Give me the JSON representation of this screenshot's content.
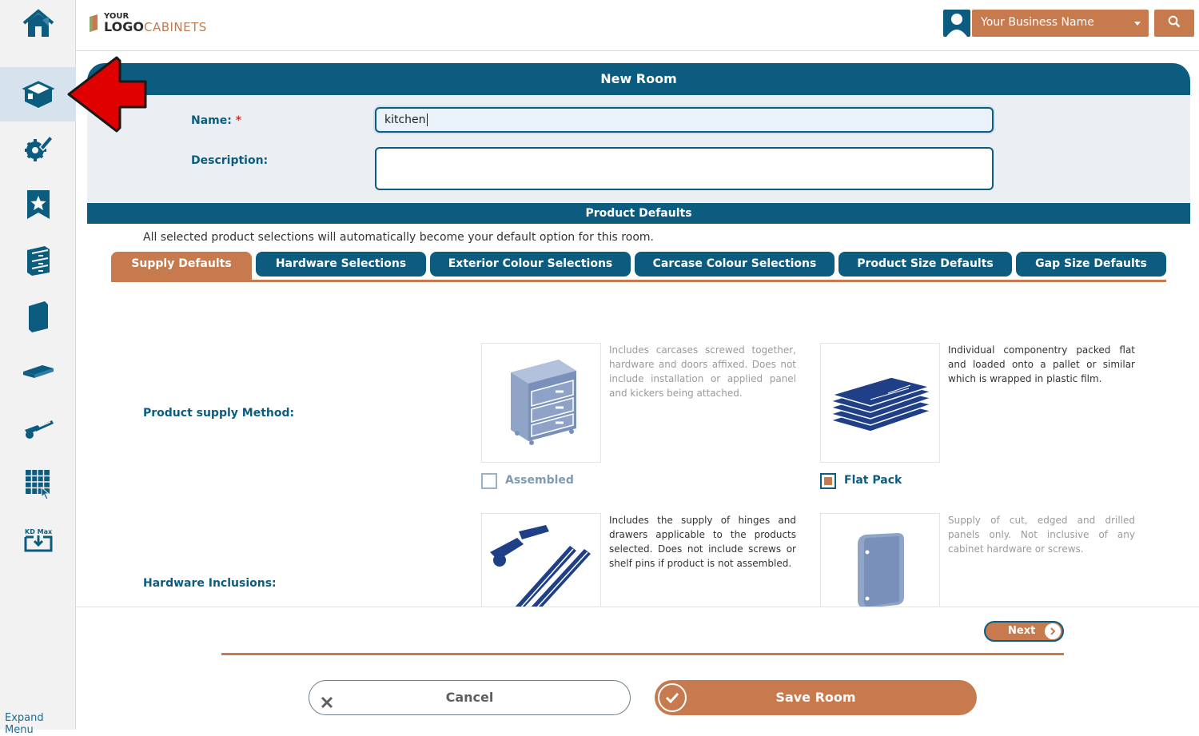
{
  "sidebar": {
    "items": [
      {
        "icon": "home-icon"
      },
      {
        "icon": "room-box-icon",
        "active": true
      },
      {
        "icon": "settings-pencil-icon"
      },
      {
        "icon": "bookmark-star-icon"
      },
      {
        "icon": "cabinet-drawers-icon"
      },
      {
        "icon": "door-panel-icon"
      },
      {
        "icon": "benchtop-icon"
      },
      {
        "icon": "hardware-hinge-icon"
      },
      {
        "icon": "grid-select-icon"
      },
      {
        "icon": "kd-max-import-icon",
        "label": "KD Max"
      }
    ],
    "expand_label": "Expand Menu"
  },
  "header": {
    "logo_your": "YOUR",
    "logo_logo": "LOGO",
    "logo_cabinets": "CABINETS",
    "business_name": "Your Business Name",
    "search_icon": "search-icon"
  },
  "room": {
    "title": "New Room",
    "name_label": "Name:",
    "required_mark": "*",
    "name_value": "kitchen",
    "description_label": "Description:",
    "description_value": ""
  },
  "product_defaults": {
    "title": "Product Defaults",
    "note": "All selected product selections will automatically become your default option for this room.",
    "tabs": [
      {
        "label": "Supply Defaults",
        "active": true
      },
      {
        "label": "Hardware Selections"
      },
      {
        "label": "Exterior Colour Selections"
      },
      {
        "label": "Carcase Colour Selections"
      },
      {
        "label": "Product Size Defaults"
      },
      {
        "label": "Gap Size Defaults"
      }
    ]
  },
  "supply_method": {
    "label": "Product supply Method:",
    "options": [
      {
        "label": "Assembled",
        "checked": false,
        "description": "Includes carcases screwed together, hardware and doors affixed. Does not include installation or applied panel and kickers being attached."
      },
      {
        "label": "Flat Pack",
        "checked": true,
        "description": "Individual componentry packed flat and loaded onto a pallet or similar which is wrapped in plastic film."
      }
    ]
  },
  "hardware_inclusions": {
    "label": "Hardware Inclusions:",
    "options": [
      {
        "description": "Includes the supply of hinges and drawers applicable to the products selected. Does not include screws or shelf pins if product is not assembled."
      },
      {
        "description": "Supply of cut, edged and drilled panels only. Not inclusive of any cabinet hardware or screws."
      }
    ]
  },
  "actions": {
    "next": "Next",
    "cancel": "Cancel",
    "save": "Save Room"
  },
  "colors": {
    "primary": "#0c5c80",
    "accent": "#c87a4f",
    "annotation_arrow": "#e10000"
  }
}
